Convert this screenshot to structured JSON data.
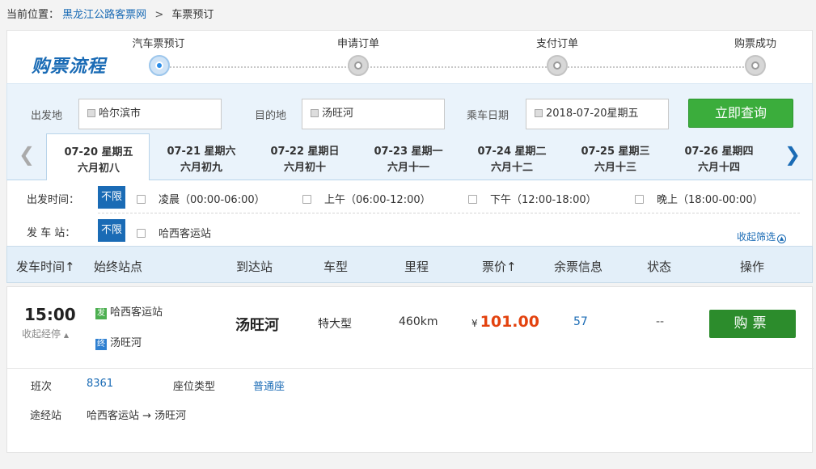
{
  "breadcrumb": {
    "prefix": "当前位置：",
    "home": "黑龙江公路客票网",
    "separator": ">",
    "current": "车票预订"
  },
  "process": {
    "title": "购票流程",
    "steps": [
      {
        "label": "汽车票预订",
        "active": true
      },
      {
        "label": "申请订单",
        "active": false
      },
      {
        "label": "支付订单",
        "active": false
      },
      {
        "label": "购票成功",
        "active": false
      }
    ]
  },
  "search": {
    "from_label": "出发地",
    "from_value": "哈尔滨市",
    "to_label": "目的地",
    "to_value": "汤旺河",
    "date_label": "乘车日期",
    "date_value": "2018-07-20星期五",
    "button": "立即查询"
  },
  "dates": [
    {
      "date": "07-20 星期五",
      "lunar": "六月初八",
      "active": true
    },
    {
      "date": "07-21 星期六",
      "lunar": "六月初九",
      "active": false
    },
    {
      "date": "07-22 星期日",
      "lunar": "六月初十",
      "active": false
    },
    {
      "date": "07-23 星期一",
      "lunar": "六月十一",
      "active": false
    },
    {
      "date": "07-24 星期二",
      "lunar": "六月十二",
      "active": false
    },
    {
      "date": "07-25 星期三",
      "lunar": "六月十三",
      "active": false
    },
    {
      "date": "07-26 星期四",
      "lunar": "六月十四",
      "active": false
    }
  ],
  "filters": {
    "time_label": "出发时间：",
    "all_label": "不限",
    "time_options": [
      "凌晨（00:00-06:00）",
      "上午（06:00-12:00）",
      "下午（12:00-18:00）",
      "晚上（18:00-00:00）"
    ],
    "station_label": "发 车 站：",
    "station_options": [
      "哈西客运站"
    ],
    "collapse_label": "收起筛选"
  },
  "table": {
    "headers": [
      "发车时间↑",
      "始终站点",
      "到达站",
      "车型",
      "里程",
      "票价↑",
      "余票信息",
      "状态",
      "操作"
    ]
  },
  "result": {
    "time": "15:00",
    "collapse_stops": "收起经停",
    "from_icon": "发",
    "from_station": "哈西客运站",
    "to_icon": "终",
    "to_station": "汤旺河",
    "destination": "汤旺河",
    "bus_type": "特大型",
    "distance": "460km",
    "currency": "¥",
    "price": "101.00",
    "seats": "57",
    "status": "--",
    "buy_button": "购票",
    "detail": {
      "schedule_label": "班次",
      "schedule_value": "8361",
      "seat_type_label": "座位类型",
      "seat_type_value": "普通座",
      "route_label": "途经站",
      "route_value": "哈西客运站 → 汤旺河"
    }
  },
  "colors": {
    "accent_blue": "#1a6bb5",
    "search_green": "#3bad3c",
    "buy_green": "#2c8c2c",
    "price_red": "#e3420e"
  }
}
